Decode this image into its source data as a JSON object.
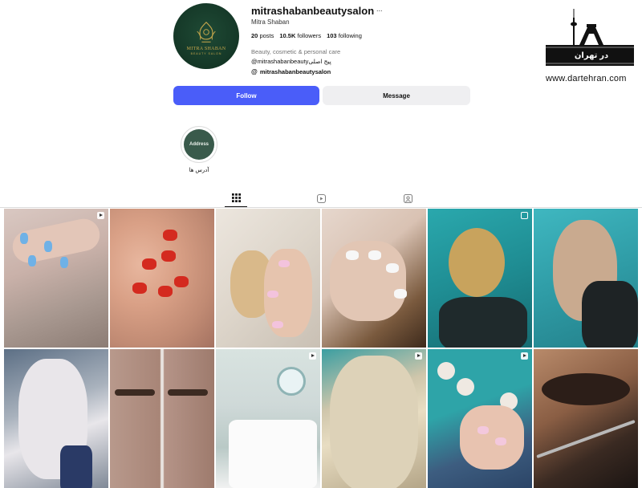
{
  "profile": {
    "username": "mitrashabanbeautysalon",
    "more_icon": "...",
    "full_name": "Mitra Shaban",
    "posts_count": "20",
    "posts_label": "posts",
    "followers_count": "10.5K",
    "followers_label": "followers",
    "following_count": "103",
    "following_label": "following",
    "category": "Beauty, cosmetic & personal care",
    "bio": "@mitrashabanbeautyپیج اصلی",
    "threads_handle": "mitrashabanbeautysalon",
    "avatar_brand": "MITRA SHABAN",
    "avatar_brand_sub": "BEAUTY SALON"
  },
  "actions": {
    "follow_label": "Follow",
    "message_label": "Message"
  },
  "highlights": [
    {
      "cover_text": "Address",
      "label": "آدرس ها"
    }
  ],
  "tabs": [
    {
      "icon": "grid-icon",
      "active": true
    },
    {
      "icon": "reels-icon",
      "active": false
    },
    {
      "icon": "tagged-icon",
      "active": false
    }
  ],
  "posts": [
    {
      "badge": "reel"
    },
    {
      "badge": ""
    },
    {
      "badge": ""
    },
    {
      "badge": ""
    },
    {
      "badge": "multi"
    },
    {
      "badge": ""
    },
    {
      "badge": ""
    },
    {
      "badge": ""
    },
    {
      "badge": "reel"
    },
    {
      "badge": "reel"
    },
    {
      "badge": "reel"
    },
    {
      "badge": ""
    }
  ],
  "watermark": {
    "url": "www.dartehran.com",
    "text": "در تهران"
  },
  "colors": {
    "follow_button": "#4a5df9",
    "message_button": "#efeff1",
    "avatar_green": "#163a29",
    "gold": "#c9a84c"
  }
}
